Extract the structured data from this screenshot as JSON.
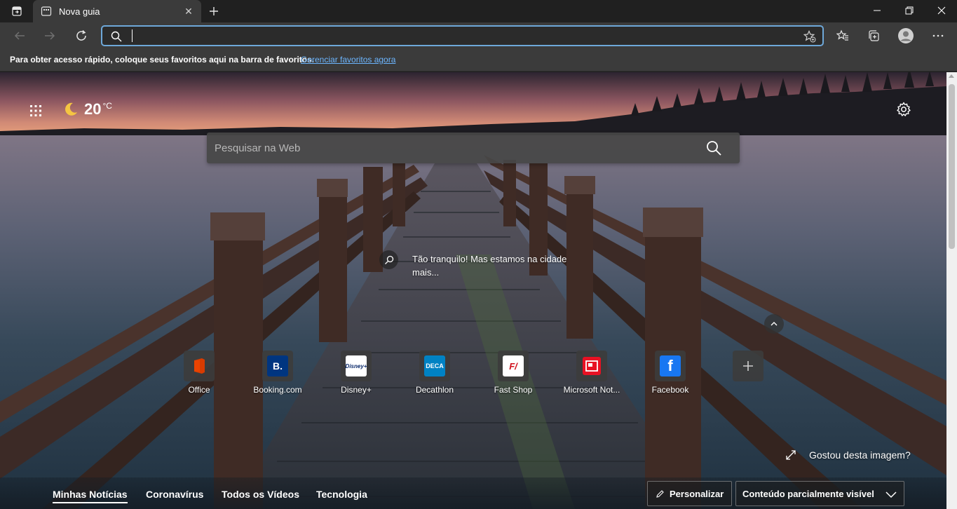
{
  "tab": {
    "title": "Nova guia",
    "close_glyph": "✕"
  },
  "window_controls": {
    "minimize_icon": "minimize-icon",
    "restore_icon": "restore-icon",
    "close_icon": "close-icon"
  },
  "address_bar": {
    "value": "",
    "placeholder": ""
  },
  "favorites_bar": {
    "message": "Para obter acesso rápido, coloque seus favoritos aqui na barra de favoritos.",
    "link": "Gerenciar favoritos agora"
  },
  "weather": {
    "icon": "moon-icon",
    "temperature": "20",
    "unit": "°C"
  },
  "web_search": {
    "placeholder": "Pesquisar na Web"
  },
  "image_caption": {
    "text": "Tão tranquilo! Mas estamos na cidade mais..."
  },
  "quick_links": [
    {
      "label": "Office",
      "glyph": "",
      "bg": "#ffffff",
      "fg": "#d83b01"
    },
    {
      "label": "Booking.com",
      "glyph": "B.",
      "bg": "#003580",
      "fg": "#ffffff"
    },
    {
      "label": "Disney+",
      "glyph": "Disney+",
      "bg": "#ffffff",
      "fg": "#0b2a6b"
    },
    {
      "label": "Decathlon",
      "glyph": "DECA",
      "bg": "#0082c3",
      "fg": "#ffffff"
    },
    {
      "label": "Fast Shop",
      "glyph": "F/",
      "bg": "#ffffff",
      "fg": "#d0101b"
    },
    {
      "label": "Microsoft Not...",
      "glyph": "",
      "bg": "#e81123",
      "fg": "#ffffff"
    },
    {
      "label": "Facebook",
      "glyph": "f",
      "bg": "#1877f2",
      "fg": "#ffffff"
    }
  ],
  "add_tile": {
    "glyph": "+"
  },
  "feedback": {
    "text": "Gostou desta imagem?"
  },
  "news": {
    "tabs": [
      "Minhas Notícias",
      "Coronavírus",
      "Todos os Vídeos",
      "Tecnologia"
    ],
    "active_tab": 0,
    "personalize_label": "Personalizar",
    "visibility_label": "Conteúdo parcialmente visível"
  }
}
